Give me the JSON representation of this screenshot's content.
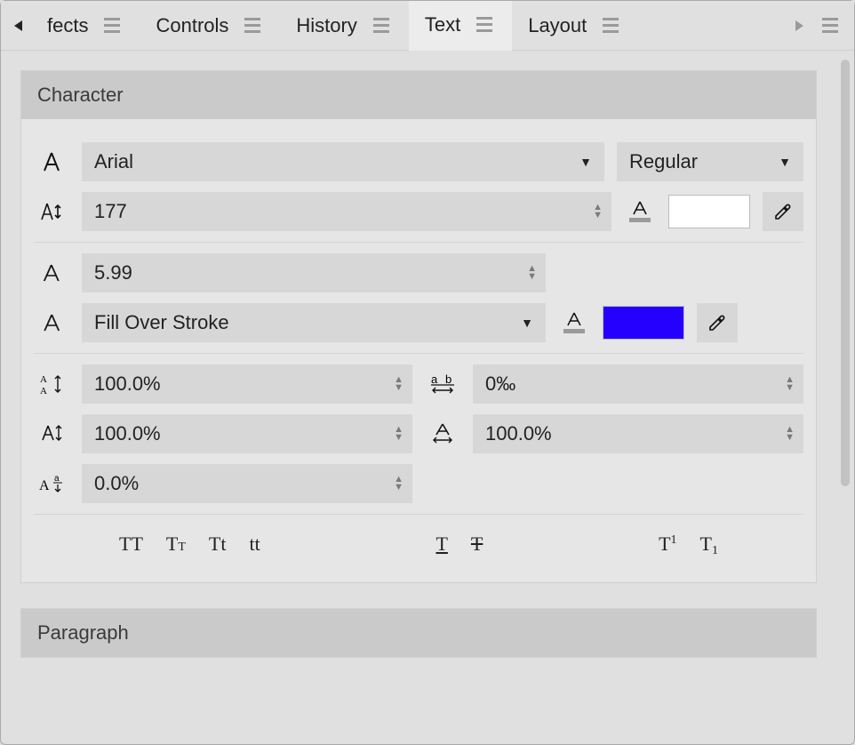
{
  "tabs": {
    "items": [
      {
        "label": "fects",
        "active": false
      },
      {
        "label": "Controls",
        "active": false
      },
      {
        "label": "History",
        "active": false
      },
      {
        "label": "Text",
        "active": true
      },
      {
        "label": "Layout",
        "active": false
      }
    ]
  },
  "panels": {
    "character": {
      "title": "Character",
      "font_family": "Arial",
      "font_style": "Regular",
      "font_size": "177",
      "fill_color": "#ffffff",
      "stroke_width": "5.99",
      "stroke_mode": "Fill Over Stroke",
      "stroke_color": "#2600ff",
      "leading": "100.0%",
      "tracking": "0‰",
      "vertical_scale": "100.0%",
      "horizontal_scale": "100.0%",
      "baseline_shift": "0.0%",
      "case_buttons": {
        "upper": "TT",
        "small_caps_a": "T",
        "small_caps_b": "T",
        "title_a": "T",
        "title_b": "t",
        "lower": "tt"
      },
      "style_buttons": {
        "underline": "T",
        "strike": "T"
      },
      "script_buttons": {
        "super_base": "T",
        "super_idx": "1",
        "sub_base": "T",
        "sub_idx": "1"
      }
    },
    "paragraph": {
      "title": "Paragraph"
    }
  }
}
